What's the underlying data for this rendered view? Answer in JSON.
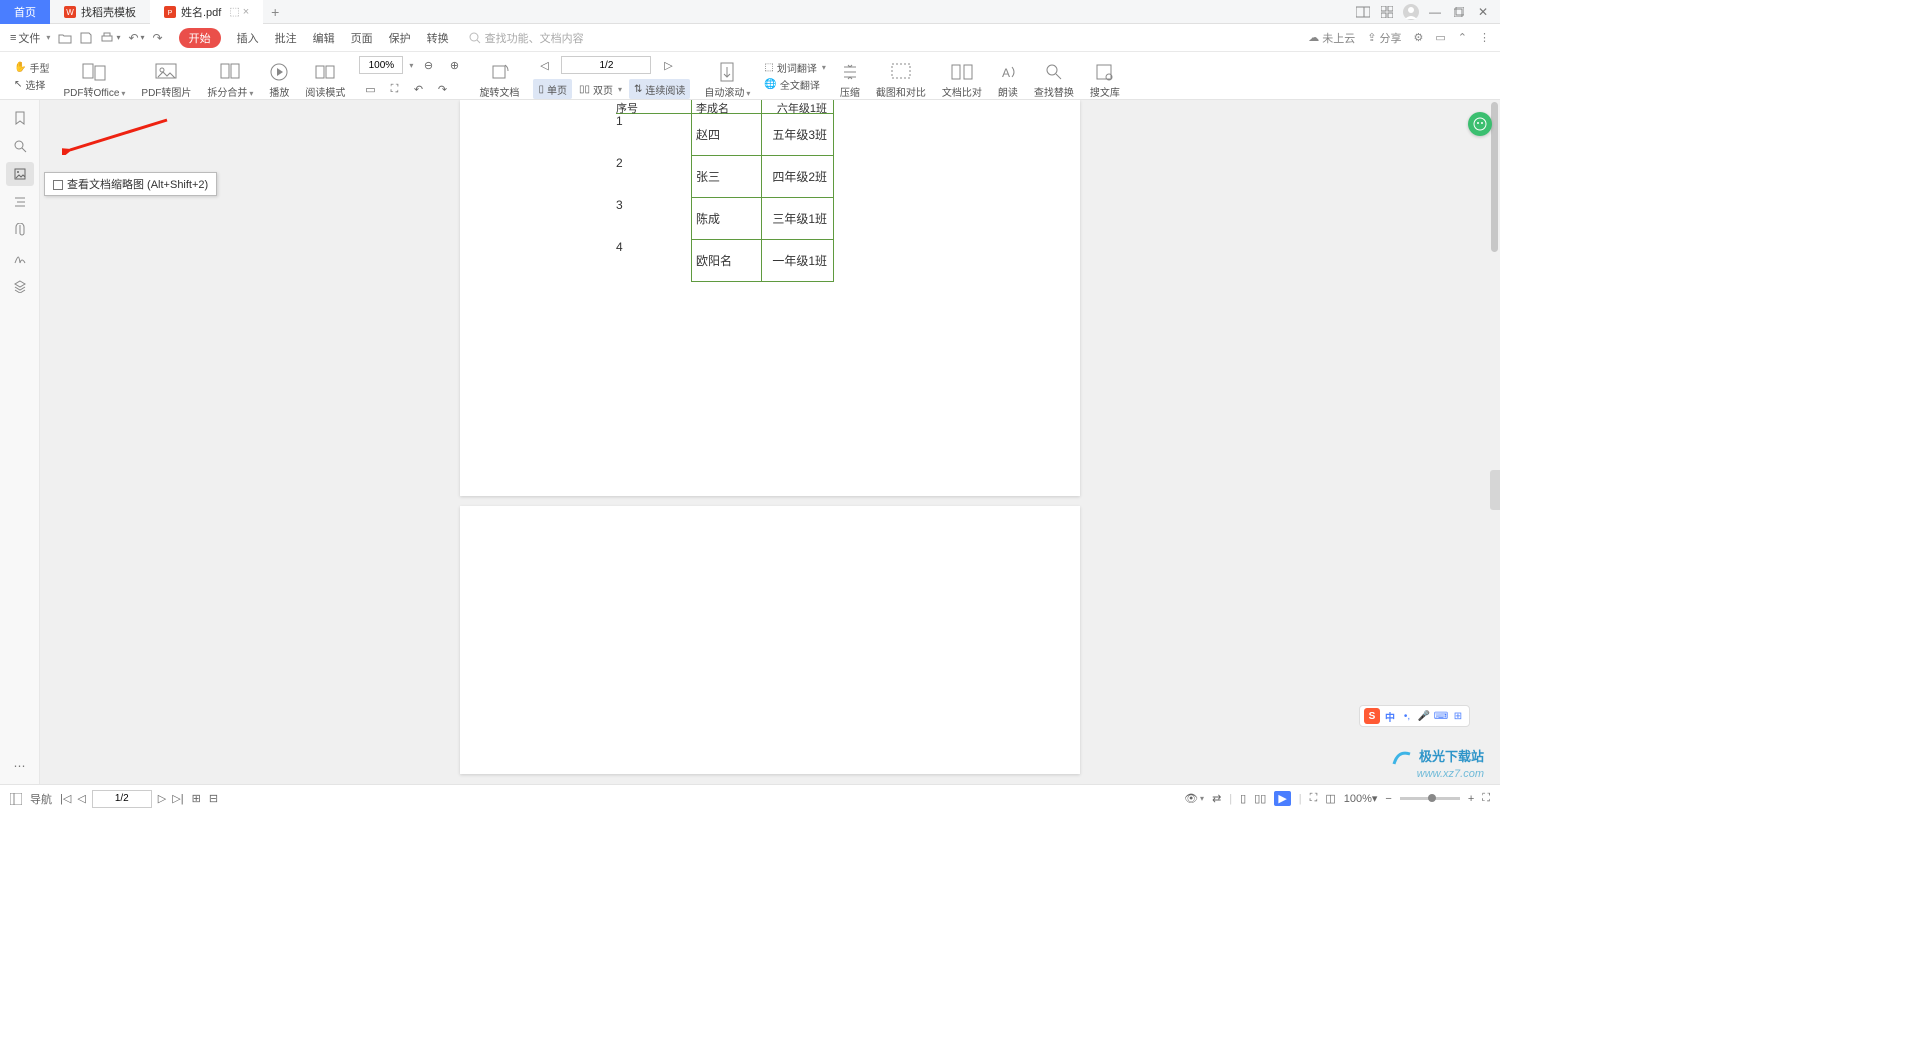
{
  "tabs": {
    "home": "首页",
    "t1": "找稻壳模板",
    "t2": "姓名.pdf",
    "dim": "⬚ ×"
  },
  "file_menu": "文件",
  "menu": {
    "start": "开始",
    "insert": "插入",
    "annot": "批注",
    "edit": "编辑",
    "page": "页面",
    "protect": "保护",
    "convert": "转换"
  },
  "search_ph": "查找功能、文档内容",
  "topr": {
    "cloud": "未上云",
    "share": "分享"
  },
  "ribbon": {
    "hand": "手型",
    "select": "选择",
    "toOffice": "PDF转Office",
    "toImg": "PDF转图片",
    "split": "拆分合并",
    "play": "播放",
    "read": "阅读模式",
    "zoom": "100%",
    "rotate": "旋转文档",
    "page_disp": "1/2",
    "single": "单页",
    "double": "双页",
    "cont": "连续阅读",
    "autoscroll": "自动滚动",
    "dict": "划词翻译",
    "fulltrans": "全文翻译",
    "compress": "压缩",
    "shotcmp": "截图和对比",
    "doccmp": "文档比对",
    "tts": "朗读",
    "findrep": "查找替换",
    "soulib": "搜文库"
  },
  "tooltip": "查看文档缩略图 (Alt+Shift+2)",
  "table": {
    "h0": "序号",
    "h1": "李成名",
    "h2": "六年级1班",
    "rows": [
      {
        "n": "1",
        "name": "赵四",
        "cls": "五年级3班"
      },
      {
        "n": "2",
        "name": "张三",
        "cls": "四年级2班"
      },
      {
        "n": "3",
        "name": "陈成",
        "cls": "三年级1班"
      },
      {
        "n": "4",
        "name": "欧阳名",
        "cls": "一年级1班"
      }
    ]
  },
  "status": {
    "nav": "导航",
    "page": "1/2",
    "zoom": "100%"
  },
  "ime": {
    "s": "S",
    "cn": "中"
  },
  "wm": {
    "a": "极光下载站",
    "b": "www.xz7.com"
  }
}
